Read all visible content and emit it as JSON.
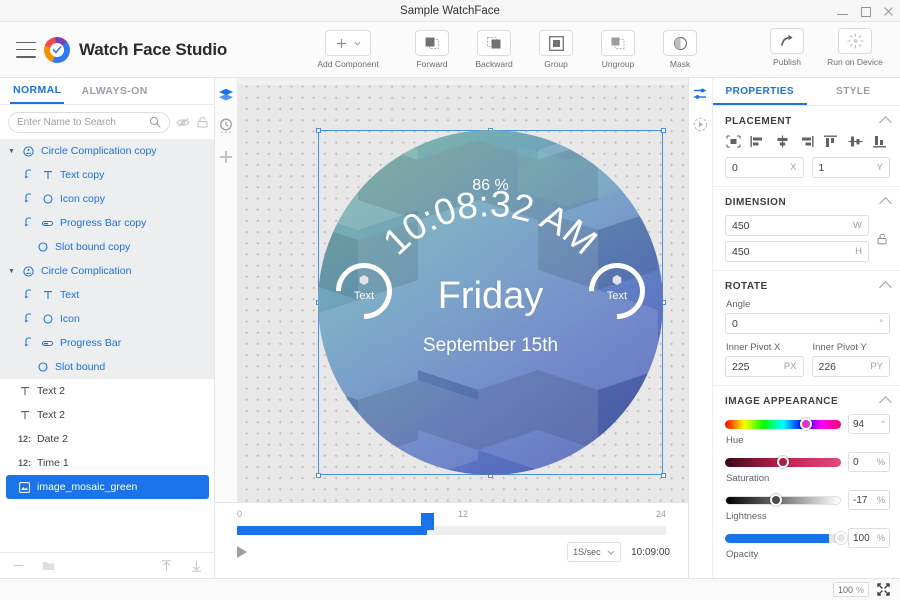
{
  "window": {
    "title": "Sample WatchFace",
    "controls": {
      "minimize": "minimize-button",
      "maximize": "maximize-button",
      "close": "close-button"
    }
  },
  "toolbar": {
    "app_name": "Watch Face Studio",
    "add_component": "Add Component",
    "tools": [
      {
        "id": "forward",
        "label": "Forward"
      },
      {
        "id": "backward",
        "label": "Backward"
      },
      {
        "id": "group",
        "label": "Group"
      },
      {
        "id": "ungroup",
        "label": "Ungroup"
      },
      {
        "id": "mask",
        "label": "Mask"
      }
    ],
    "right_tools": [
      {
        "id": "publish",
        "label": "Publish"
      },
      {
        "id": "run-on-device",
        "label": "Run on Device"
      }
    ]
  },
  "left_panel": {
    "tabs": [
      {
        "label": "NORMAL",
        "active": true
      },
      {
        "label": "ALWAYS-ON",
        "active": false
      }
    ],
    "search": {
      "placeholder": "Enter Name to Search",
      "value": ""
    },
    "layers": [
      {
        "name": "Circle Complication copy",
        "type": "group",
        "indent": 0,
        "icon": "complication-icon",
        "selected": false,
        "highlight": true
      },
      {
        "name": "Text copy",
        "type": "child",
        "indent": 1,
        "icon": "text-icon",
        "selected": false,
        "highlight": true
      },
      {
        "name": "Icon copy",
        "type": "child",
        "indent": 1,
        "icon": "circle-icon",
        "selected": false,
        "highlight": true
      },
      {
        "name": "Progress Bar copy",
        "type": "child",
        "indent": 1,
        "icon": "progressbar-icon",
        "selected": false,
        "highlight": true
      },
      {
        "name": "Slot bound copy",
        "type": "child",
        "indent": 1,
        "icon": "circle-icon",
        "selected": false,
        "highlight": true,
        "nobind": true
      },
      {
        "name": "Circle Complication",
        "type": "group",
        "indent": 0,
        "icon": "complication-icon",
        "selected": false,
        "highlight": true
      },
      {
        "name": "Text",
        "type": "child",
        "indent": 1,
        "icon": "text-icon",
        "selected": false,
        "highlight": true
      },
      {
        "name": "Icon",
        "type": "child",
        "indent": 1,
        "icon": "circle-icon",
        "selected": false,
        "highlight": true
      },
      {
        "name": "Progress Bar",
        "type": "child",
        "indent": 1,
        "icon": "progressbar-icon",
        "selected": false,
        "highlight": true
      },
      {
        "name": "Slot bound",
        "type": "child",
        "indent": 1,
        "icon": "circle-icon",
        "selected": false,
        "highlight": true,
        "nobind": true
      },
      {
        "name": "Text 2",
        "type": "plain",
        "indent": 0,
        "icon": "text-icon",
        "selected": false,
        "highlight": false
      },
      {
        "name": "Text 2",
        "type": "plain",
        "indent": 0,
        "icon": "text-icon",
        "selected": false,
        "highlight": false
      },
      {
        "name": "Date 2",
        "type": "plain",
        "indent": 0,
        "icon": "digit-icon",
        "selected": false,
        "highlight": false
      },
      {
        "name": "Time 1",
        "type": "plain",
        "indent": 0,
        "icon": "digit-icon",
        "selected": false,
        "highlight": false
      },
      {
        "name": "image_mosaic_green",
        "type": "plain",
        "indent": 0,
        "icon": "image-icon",
        "selected": true,
        "highlight": false
      }
    ],
    "footer_icons": [
      "minus-icon",
      "folder-icon",
      "move-up-icon",
      "move-down-icon"
    ],
    "search_side_icons": [
      "eye-off-icon",
      "lock-open-icon"
    ]
  },
  "canvas_rail": [
    "layers-icon",
    "time-icon",
    "add-icon"
  ],
  "watch_face": {
    "battery": "86 %",
    "time": "10:08:32 AM",
    "day": "Friday",
    "date": "September 15th",
    "left_complication_label": "Text",
    "right_complication_label": "Text"
  },
  "timeline": {
    "ticks": [
      "0",
      "12",
      "24"
    ],
    "playhead_value": 11,
    "range": [
      0,
      24
    ],
    "speed": "1S/sec",
    "current_time": "10:09:00"
  },
  "right_panel": {
    "tabs": [
      {
        "label": "PROPERTIES",
        "active": true
      },
      {
        "label": "STYLE",
        "active": false
      }
    ],
    "rail_icons": [
      "sliders-icon",
      "play-circle-icon"
    ],
    "placement": {
      "title": "PLACEMENT",
      "align_icons": [
        "align-center-both-icon",
        "align-left-icon",
        "align-horizontal-center-icon",
        "align-right-icon",
        "align-top-icon",
        "align-vertical-center-icon",
        "align-bottom-icon"
      ],
      "x": {
        "value": "0",
        "unit": "X"
      },
      "y": {
        "value": "1",
        "unit": "Y"
      }
    },
    "dimension": {
      "title": "DIMENSION",
      "width": {
        "value": "450",
        "unit": "W"
      },
      "height": {
        "value": "450",
        "unit": "H"
      },
      "lock": "lock-open-icon"
    },
    "rotate": {
      "title": "ROTATE",
      "angle_label": "Angle",
      "angle": {
        "value": "0",
        "unit": "°"
      },
      "pivot_x_label": "Inner Pivot X",
      "pivot_y_label": "Inner Pivot Y",
      "pivot_x": {
        "value": "225",
        "unit": "PX"
      },
      "pivot_y": {
        "value": "226",
        "unit": "PY"
      }
    },
    "image_appearance": {
      "title": "IMAGE APPEARANCE",
      "sliders": [
        {
          "label": "Hue",
          "value": "94",
          "unit": "°",
          "pct": 70,
          "track": "hue"
        },
        {
          "label": "Saturation",
          "value": "0",
          "unit": "%",
          "pct": 50,
          "track": "sat"
        },
        {
          "label": "Lightness",
          "value": "-17",
          "unit": "%",
          "pct": 44,
          "track": "lit"
        },
        {
          "label": "Opacity",
          "value": "100",
          "unit": "%",
          "pct": 100,
          "track": "opa"
        }
      ]
    }
  },
  "status_bar": {
    "zoom": "100",
    "zoom_unit": "%",
    "fit_icon": "fit-to-screen-icon"
  },
  "colors": {
    "accent": "#1a73e8",
    "panel_bg": "#ffffff",
    "canvas_bg": "#e8e8e8",
    "selected_layer": "#1a73e8"
  }
}
